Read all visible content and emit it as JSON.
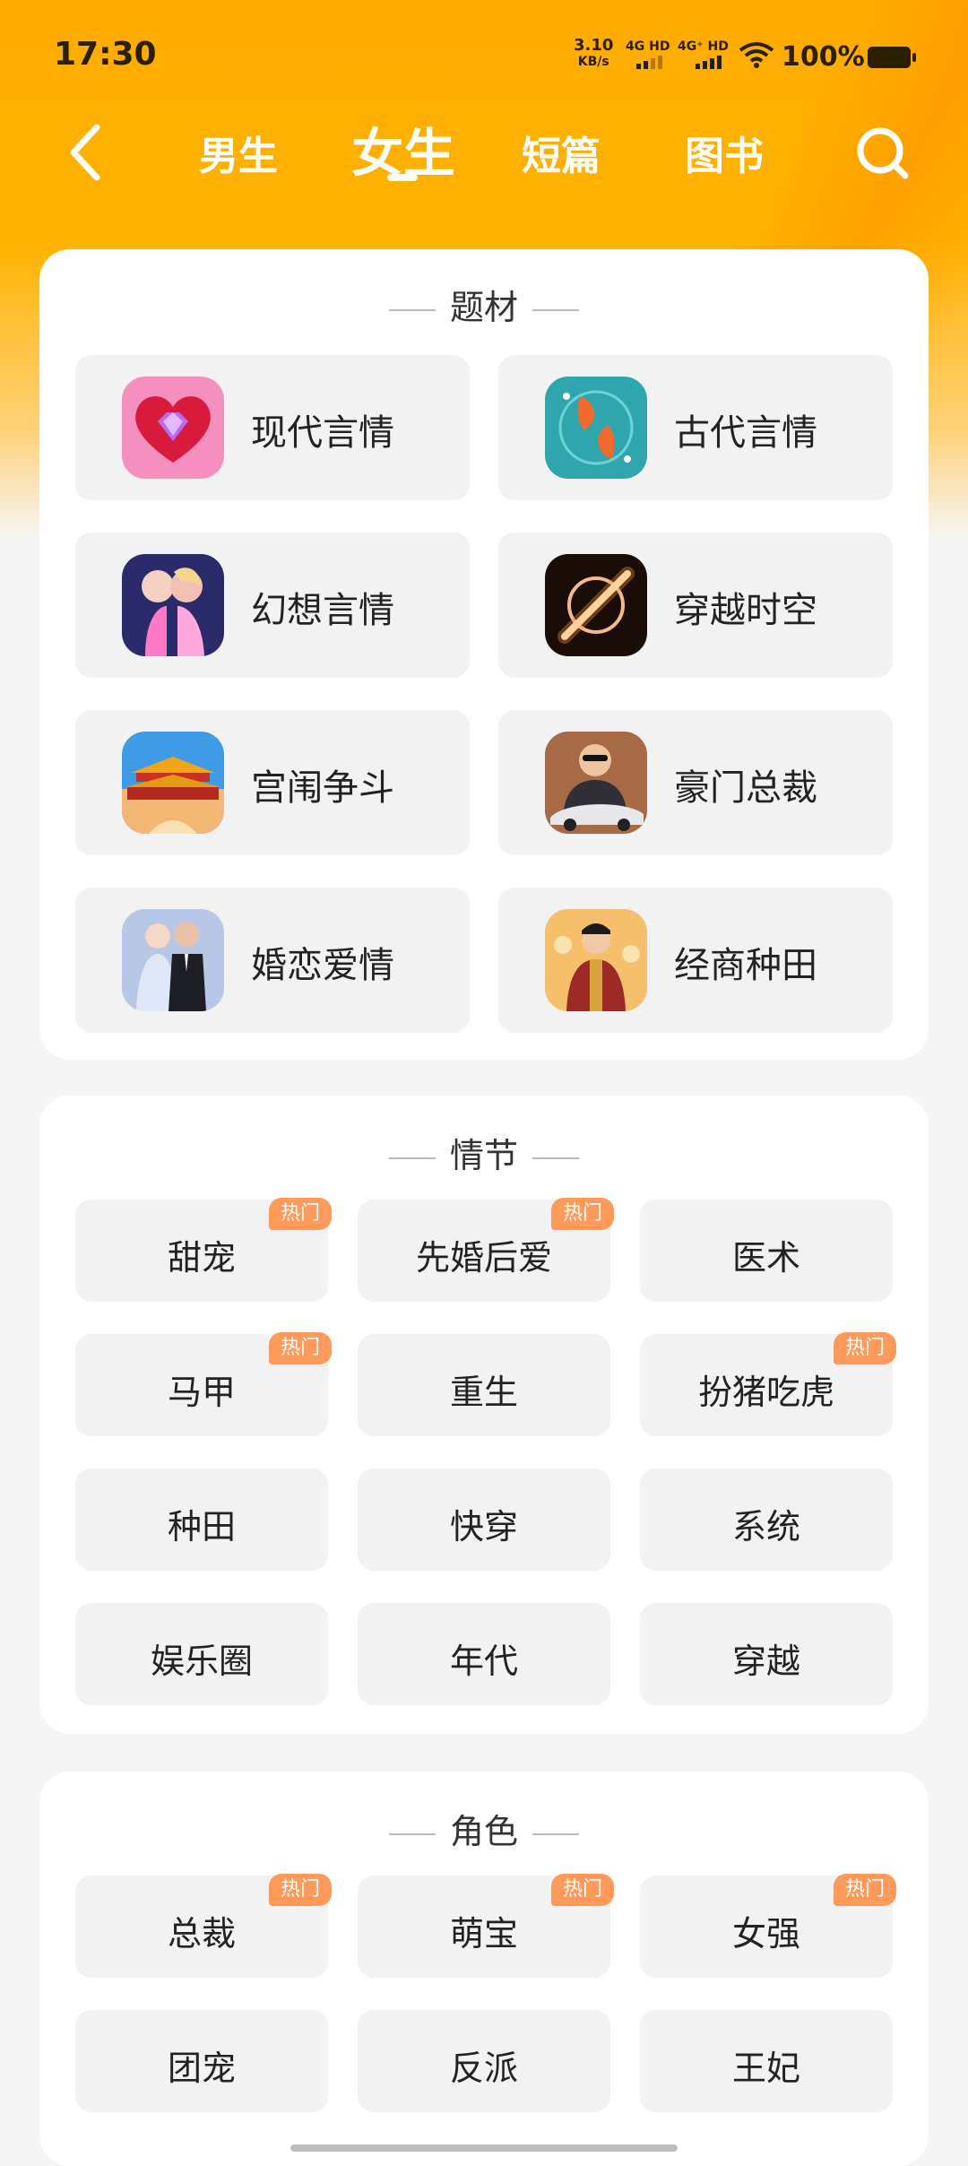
{
  "status_bar": {
    "time": "17:30",
    "net_speed_value": "3.10",
    "net_speed_unit": "KB/s",
    "sim1": "4G HD",
    "sim2": "4G⁺ HD",
    "battery": "100%"
  },
  "nav": {
    "tabs": [
      "男生",
      "女生",
      "短篇",
      "图书"
    ],
    "active_tab": "女生"
  },
  "themes": {
    "title": "题材",
    "items": [
      {
        "label": "现代言情",
        "icon": "heart-gem-icon"
      },
      {
        "label": "古代言情",
        "icon": "koi-fish-icon"
      },
      {
        "label": "幻想言情",
        "icon": "couple-kiss-icon"
      },
      {
        "label": "穿越时空",
        "icon": "portal-icon"
      },
      {
        "label": "宫闱争斗",
        "icon": "palace-icon"
      },
      {
        "label": "豪门总裁",
        "icon": "ceo-car-icon"
      },
      {
        "label": "婚恋爱情",
        "icon": "wedding-couple-icon"
      },
      {
        "label": "经商种田",
        "icon": "merchant-icon"
      }
    ]
  },
  "plots": {
    "title": "情节",
    "items": [
      {
        "label": "甜宠",
        "hot": "热门"
      },
      {
        "label": "先婚后爱",
        "hot": "热门"
      },
      {
        "label": "医术",
        "hot": ""
      },
      {
        "label": "马甲",
        "hot": "热门"
      },
      {
        "label": "重生",
        "hot": ""
      },
      {
        "label": "扮猪吃虎",
        "hot": "热门"
      },
      {
        "label": "种田",
        "hot": ""
      },
      {
        "label": "快穿",
        "hot": ""
      },
      {
        "label": "系统",
        "hot": ""
      },
      {
        "label": "娱乐圈",
        "hot": ""
      },
      {
        "label": "年代",
        "hot": ""
      },
      {
        "label": "穿越",
        "hot": ""
      }
    ]
  },
  "roles": {
    "title": "角色",
    "items": [
      {
        "label": "总裁",
        "hot": "热门"
      },
      {
        "label": "萌宝",
        "hot": "热门"
      },
      {
        "label": "女强",
        "hot": "热门"
      },
      {
        "label": "团宠",
        "hot": ""
      },
      {
        "label": "反派",
        "hot": ""
      },
      {
        "label": "王妃",
        "hot": ""
      }
    ]
  },
  "colors": {
    "header": "#ffab00",
    "hot_badge": "#ff9a5a",
    "tile_bg": "#f2f2f2"
  }
}
